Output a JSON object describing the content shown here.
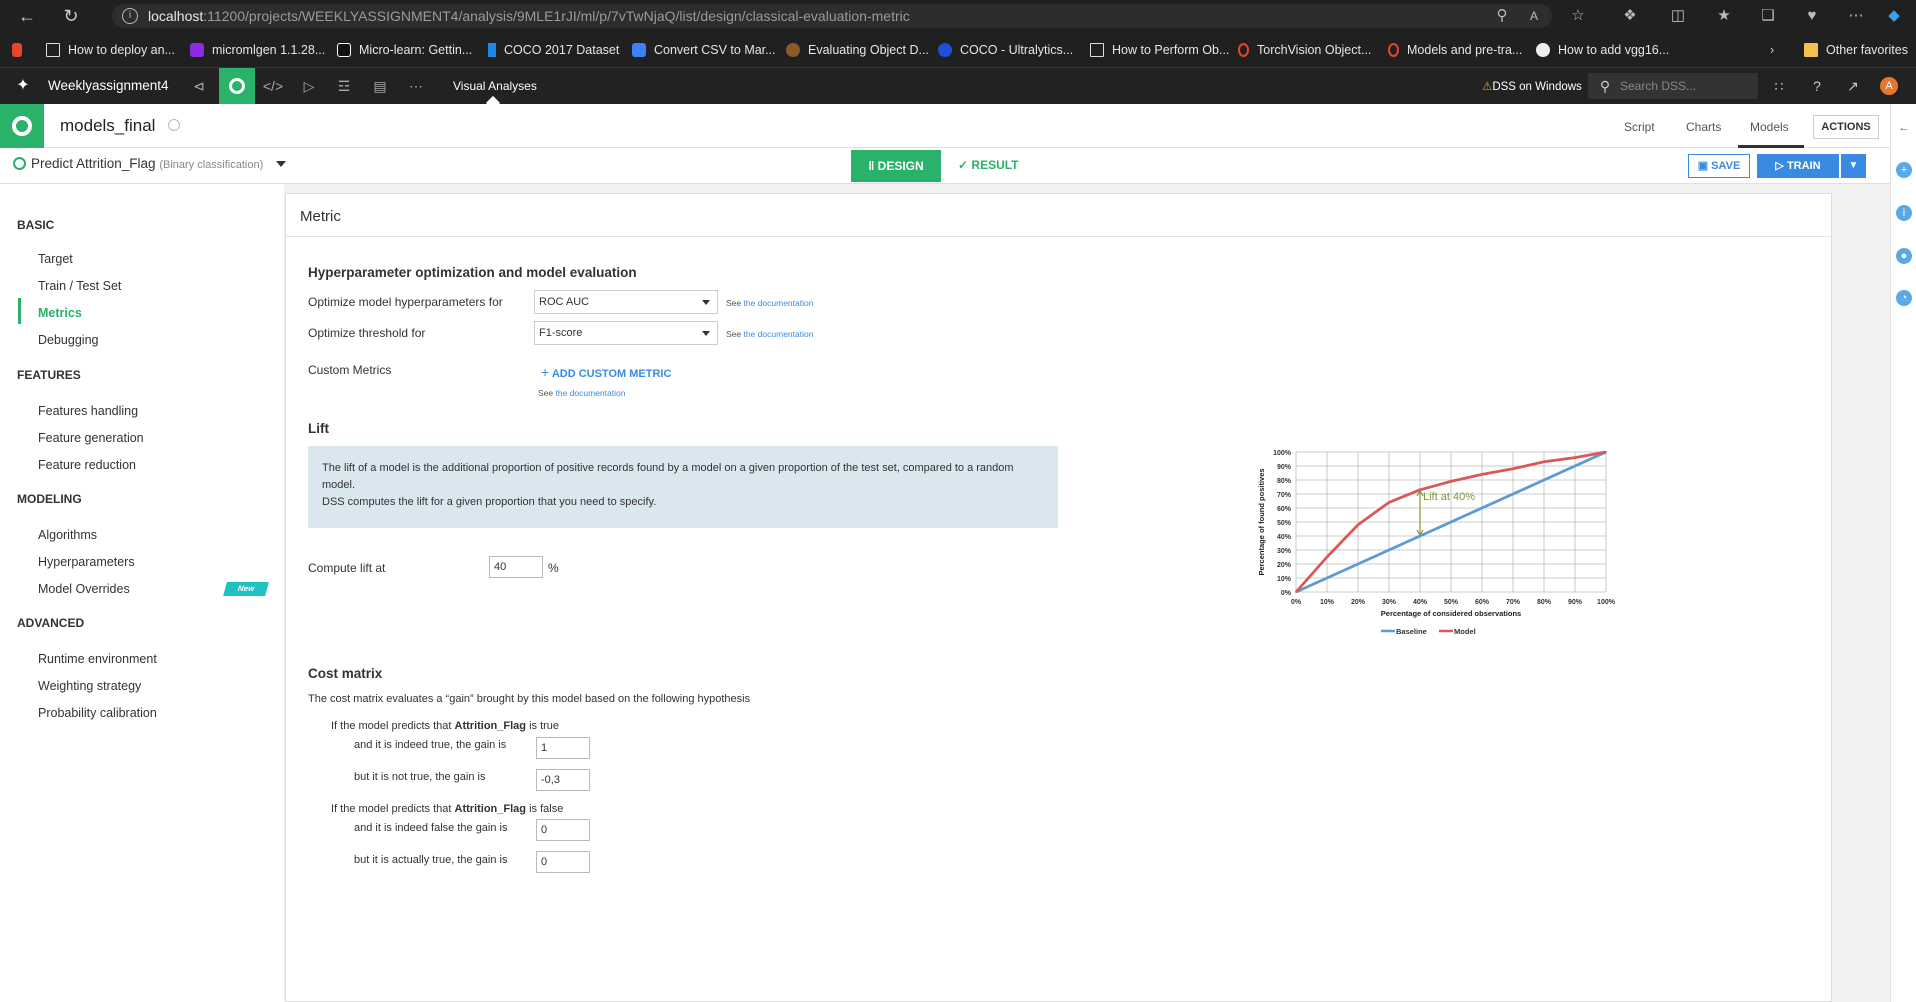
{
  "browser": {
    "url_host": "localhost",
    "url_rest": ":11200/projects/WEEKLYASSIGNMENT4/analysis/9MLE1rJI/ml/p/7vTwNjaQ/list/design/classical-evaluation-metric",
    "bookmarks": [
      "How to deploy an...",
      "micromlgen 1.1.28...",
      "Micro-learn: Gettin...",
      "COCO 2017 Dataset",
      "Convert CSV to Mar...",
      "Evaluating Object D...",
      "COCO - Ultralytics...",
      "How to Perform Ob...",
      "TorchVision Object...",
      "Models and pre-tra...",
      "How to add vgg16..."
    ],
    "other_favorites": "Other favorites"
  },
  "topbar": {
    "project": "Weeklyassignment4",
    "visual_analyses": "Visual Analyses",
    "dss_on_windows": "DSS on Windows",
    "search_placeholder": "Search DSS...",
    "avatar_letter": "A"
  },
  "header": {
    "title": "models_final",
    "tabs": [
      "Script",
      "Charts",
      "Models"
    ],
    "actions": "ACTIONS"
  },
  "predict": {
    "title": "Predict Attrition_Flag",
    "subtitle": "(Binary classification)",
    "design": "DESIGN",
    "result": "RESULT",
    "save": "SAVE",
    "train": "TRAIN"
  },
  "leftnav": {
    "basic": "BASIC",
    "basic_items": [
      "Target",
      "Train / Test Set",
      "Metrics",
      "Debugging"
    ],
    "features": "FEATURES",
    "features_items": [
      "Features handling",
      "Feature generation",
      "Feature reduction"
    ],
    "modeling": "MODELING",
    "modeling_items": [
      "Algorithms",
      "Hyperparameters",
      "Model Overrides"
    ],
    "new_badge": "New",
    "advanced": "ADVANCED",
    "advanced_items": [
      "Runtime environment",
      "Weighting strategy",
      "Probability calibration"
    ]
  },
  "metric": {
    "title": "Metric",
    "hpo_heading": "Hyperparameter optimization and model evaluation",
    "opt_hyper_label": "Optimize model hyperparameters for",
    "opt_hyper_value": "ROC AUC",
    "opt_thresh_label": "Optimize threshold for",
    "opt_thresh_value": "F1-score",
    "see": "See",
    "doc_link": "the documentation",
    "custom_metrics_label": "Custom Metrics",
    "add_custom_metric": "ADD CUSTOM METRIC",
    "lift_heading": "Lift",
    "lift_info_1": "The lift of a model is the additional proportion of positive records found by a model on a given proportion of the test set, compared to a random model.",
    "lift_info_2": "DSS computes the lift for a given proportion that you need to specify.",
    "compute_lift_label": "Compute lift at",
    "compute_lift_value": "40",
    "compute_lift_unit": "%",
    "cost_heading": "Cost matrix",
    "cost_desc": "The cost matrix evaluates a “gain” brought by this model based on the following hypothesis",
    "if_true_pre": "If the model predicts that",
    "target_name": "Attrition_Flag",
    "if_true_post": "is true",
    "if_false_post": "is false",
    "tt_label": "and it is indeed true, the gain is",
    "tt_value": "1",
    "tf_label": "but it is not true, the gain is",
    "tf_value": "-0,3",
    "ff_label": "and it is indeed false the gain is",
    "ff_value": "0",
    "ft_label": "but it is actually true, the gain is",
    "ft_value": "0"
  },
  "chart_data": {
    "type": "line",
    "x": [
      0,
      10,
      20,
      30,
      40,
      50,
      60,
      70,
      80,
      90,
      100
    ],
    "series": [
      {
        "name": "Baseline",
        "color": "#5b9bd5",
        "values": [
          0,
          10,
          20,
          30,
          40,
          50,
          60,
          70,
          80,
          90,
          100
        ]
      },
      {
        "name": "Model",
        "color": "#d9585a",
        "values": [
          0,
          25,
          48,
          64,
          73,
          79,
          84,
          88,
          93,
          96,
          100
        ]
      }
    ],
    "xlabel": "Percentage of considered observations",
    "ylabel": "Percentage of found positives",
    "xticks": [
      "0%",
      "10%",
      "20%",
      "30%",
      "40%",
      "50%",
      "60%",
      "70%",
      "80%",
      "90%",
      "100%"
    ],
    "yticks": [
      "0%",
      "10%",
      "20%",
      "30%",
      "40%",
      "50%",
      "60%",
      "70%",
      "80%",
      "90%",
      "100%"
    ],
    "xlim": [
      0,
      100
    ],
    "ylim": [
      0,
      100
    ],
    "grid": true,
    "legend": "bottom",
    "annotation": "Lift at 40%",
    "annotation_x": 40,
    "annotation_color": "#7a9a3a"
  }
}
